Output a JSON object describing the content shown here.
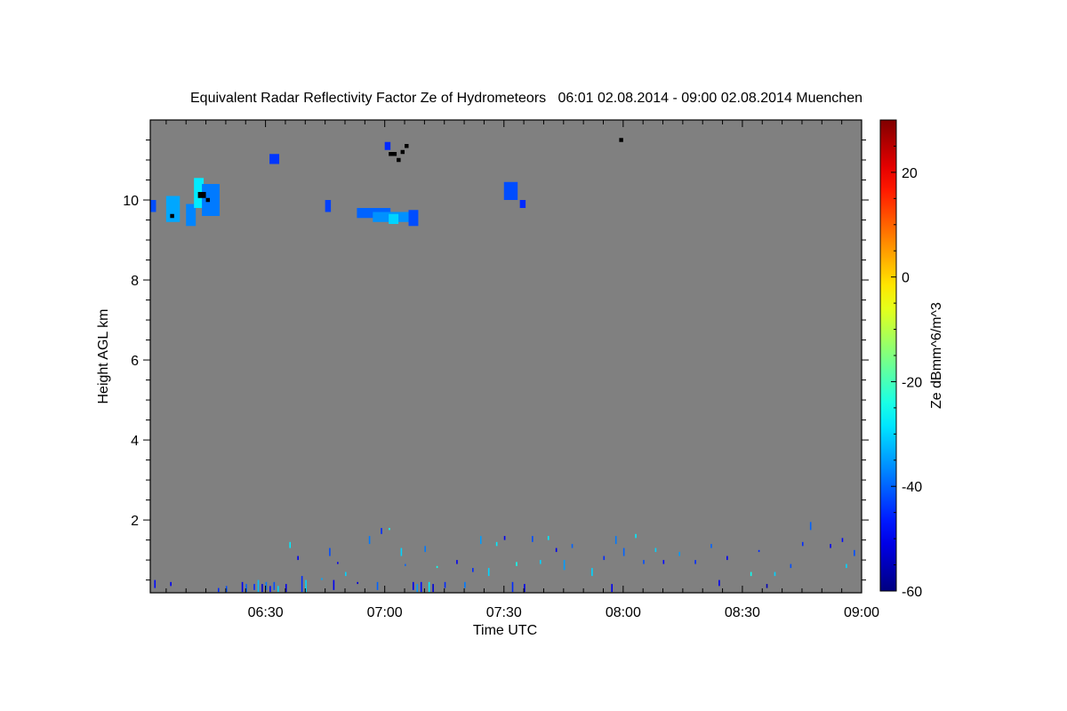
{
  "chart_data": {
    "type": "heatmap",
    "title": "Equivalent Radar Reflectivity Factor Ze of Hydrometeors   06:01 02.08.2014 - 09:00 02.08.2014 Muenchen",
    "xlabel": "Time UTC",
    "ylabel": "Height AGL km",
    "xlim": [
      "06:01",
      "09:00"
    ],
    "ylim": [
      0.18,
      12.0
    ],
    "xticks": [
      "06:30",
      "07:00",
      "07:30",
      "08:00",
      "08:30",
      "09:00"
    ],
    "yticks": [
      2,
      4,
      6,
      8,
      10
    ],
    "background_color": "#808080",
    "colorbar": {
      "label": "Ze dBmm^6/m^3",
      "range": [
        -60,
        30
      ],
      "ticks": [
        -60,
        -40,
        -20,
        0,
        20
      ],
      "colormap": "jet"
    },
    "echoes": [
      {
        "start": "06:01",
        "end": "06:02",
        "h": [
          9.7,
          10.0
        ],
        "ze": -42
      },
      {
        "start": "06:05",
        "end": "06:08",
        "h": [
          9.45,
          10.1
        ],
        "ze": -34
      },
      {
        "start": "06:10",
        "end": "06:12",
        "h": [
          9.35,
          9.9
        ],
        "ze": -37
      },
      {
        "start": "06:12",
        "end": "06:14",
        "h": [
          9.8,
          10.55
        ],
        "ze": -28
      },
      {
        "start": "06:14",
        "end": "06:18",
        "h": [
          9.6,
          10.4
        ],
        "ze": -38
      },
      {
        "start": "06:31",
        "end": "06:33",
        "h": [
          10.9,
          11.15
        ],
        "ze": -44
      },
      {
        "start": "06:45",
        "end": "06:46",
        "h": [
          9.7,
          10.0
        ],
        "ze": -43
      },
      {
        "start": "06:53",
        "end": "07:01",
        "h": [
          9.55,
          9.8
        ],
        "ze": -40
      },
      {
        "start": "06:57",
        "end": "07:06",
        "h": [
          9.45,
          9.7
        ],
        "ze": -36
      },
      {
        "start": "07:01",
        "end": "07:03",
        "h": [
          9.4,
          9.65
        ],
        "ze": -30
      },
      {
        "start": "07:06",
        "end": "07:08",
        "h": [
          9.35,
          9.75
        ],
        "ze": -42
      },
      {
        "start": "07:00",
        "end": "07:01",
        "h": [
          11.25,
          11.45
        ],
        "ze": -45
      },
      {
        "start": "07:30",
        "end": "07:33",
        "h": [
          10.0,
          10.45
        ],
        "ze": -42
      },
      {
        "start": "07:34",
        "end": "07:35",
        "h": [
          9.8,
          10.0
        ],
        "ze": -45
      }
    ],
    "no_data_flags": [
      {
        "start": "06:06",
        "end": "06:07",
        "h": [
          9.55,
          9.65
        ]
      },
      {
        "start": "06:13",
        "end": "06:15",
        "h": [
          10.05,
          10.2
        ]
      },
      {
        "start": "06:15",
        "end": "06:16",
        "h": [
          9.95,
          10.05
        ]
      },
      {
        "start": "07:01",
        "end": "07:03",
        "h": [
          11.1,
          11.2
        ]
      },
      {
        "start": "07:04",
        "end": "07:05",
        "h": [
          11.15,
          11.25
        ]
      },
      {
        "start": "07:05",
        "end": "07:06",
        "h": [
          11.3,
          11.4
        ]
      },
      {
        "start": "07:03",
        "end": "07:04",
        "h": [
          10.95,
          11.05
        ]
      },
      {
        "start": "07:59",
        "end": "08:00",
        "h": [
          11.45,
          11.55
        ]
      }
    ],
    "specks": [
      [
        "06:02",
        0.3,
        0.5,
        -48
      ],
      [
        "06:06",
        0.35,
        0.45,
        -50
      ],
      [
        "06:18",
        0.2,
        0.3,
        -45
      ],
      [
        "06:20",
        0.2,
        0.35,
        -42
      ],
      [
        "06:24",
        0.2,
        0.45,
        -50
      ],
      [
        "06:25",
        0.2,
        0.4,
        -40
      ],
      [
        "06:27",
        0.25,
        0.4,
        -45
      ],
      [
        "06:28",
        0.2,
        0.5,
        -32
      ],
      [
        "06:29",
        0.2,
        0.4,
        -52
      ],
      [
        "06:30",
        0.25,
        0.45,
        -38
      ],
      [
        "06:31",
        0.2,
        0.35,
        -48
      ],
      [
        "06:32",
        0.25,
        0.45,
        -42
      ],
      [
        "06:33",
        0.2,
        0.35,
        -30
      ],
      [
        "06:35",
        0.2,
        0.4,
        -50
      ],
      [
        "06:36",
        1.3,
        1.45,
        -28
      ],
      [
        "06:38",
        1.0,
        1.1,
        -50
      ],
      [
        "06:39",
        0.2,
        0.6,
        -45
      ],
      [
        "06:40",
        0.2,
        0.5,
        -30
      ],
      [
        "06:44",
        0.5,
        0.55,
        -34
      ],
      [
        "06:46",
        1.1,
        1.3,
        -42
      ],
      [
        "06:47",
        0.25,
        0.5,
        -50
      ],
      [
        "06:48",
        0.9,
        0.95,
        -50
      ],
      [
        "06:50",
        0.6,
        0.7,
        -30
      ],
      [
        "06:53",
        0.4,
        0.45,
        -52
      ],
      [
        "06:56",
        1.4,
        1.6,
        -38
      ],
      [
        "06:58",
        0.25,
        0.45,
        -40
      ],
      [
        "06:59",
        1.65,
        1.8,
        -45
      ],
      [
        "07:01",
        1.75,
        1.8,
        -25
      ],
      [
        "07:04",
        1.1,
        1.3,
        -30
      ],
      [
        "07:05",
        0.85,
        0.9,
        -40
      ],
      [
        "07:07",
        0.25,
        0.45,
        -50
      ],
      [
        "07:08",
        0.2,
        0.4,
        -35
      ],
      [
        "07:09",
        0.2,
        0.45,
        -48
      ],
      [
        "07:10",
        1.2,
        1.35,
        -38
      ],
      [
        "07:11",
        0.2,
        0.45,
        -28
      ],
      [
        "07:12",
        0.2,
        0.4,
        -52
      ],
      [
        "07:13",
        0.8,
        0.85,
        -25
      ],
      [
        "07:15",
        0.3,
        0.45,
        -45
      ],
      [
        "07:18",
        0.9,
        1.0,
        -50
      ],
      [
        "07:20",
        0.3,
        0.45,
        -38
      ],
      [
        "07:22",
        0.7,
        0.8,
        -45
      ],
      [
        "07:24",
        1.4,
        1.6,
        -35
      ],
      [
        "07:26",
        0.6,
        0.8,
        -30
      ],
      [
        "07:28",
        1.35,
        1.45,
        -28
      ],
      [
        "07:30",
        1.5,
        1.6,
        -50
      ],
      [
        "07:32",
        0.2,
        0.45,
        -45
      ],
      [
        "07:33",
        0.85,
        0.95,
        -25
      ],
      [
        "07:35",
        0.2,
        0.4,
        -50
      ],
      [
        "07:37",
        1.45,
        1.6,
        -42
      ],
      [
        "07:39",
        0.9,
        1.0,
        -30
      ],
      [
        "07:41",
        1.5,
        1.6,
        -28
      ],
      [
        "07:43",
        1.2,
        1.3,
        -50
      ],
      [
        "07:45",
        0.75,
        1.0,
        -35
      ],
      [
        "07:47",
        1.3,
        1.4,
        -40
      ],
      [
        "07:52",
        0.6,
        0.8,
        -30
      ],
      [
        "07:55",
        1.0,
        1.1,
        -45
      ],
      [
        "07:57",
        0.2,
        0.4,
        -50
      ],
      [
        "07:58",
        1.4,
        1.6,
        -38
      ],
      [
        "08:00",
        1.1,
        1.3,
        -40
      ],
      [
        "08:03",
        1.55,
        1.65,
        -28
      ],
      [
        "08:05",
        0.9,
        1.0,
        -42
      ],
      [
        "08:08",
        1.2,
        1.3,
        -30
      ],
      [
        "08:10",
        0.9,
        1.0,
        -48
      ],
      [
        "08:14",
        1.1,
        1.2,
        -35
      ],
      [
        "08:18",
        0.9,
        1.0,
        -45
      ],
      [
        "08:22",
        1.3,
        1.4,
        -40
      ],
      [
        "08:24",
        0.35,
        0.5,
        -50
      ],
      [
        "08:26",
        1.0,
        1.1,
        -50
      ],
      [
        "08:32",
        0.6,
        0.7,
        -25
      ],
      [
        "08:34",
        1.2,
        1.25,
        -45
      ],
      [
        "08:36",
        0.3,
        0.4,
        -55
      ],
      [
        "08:38",
        0.6,
        0.7,
        -30
      ],
      [
        "08:42",
        0.8,
        0.9,
        -42
      ],
      [
        "08:45",
        1.35,
        1.45,
        -45
      ],
      [
        "08:47",
        1.75,
        1.95,
        -40
      ],
      [
        "08:52",
        1.3,
        1.4,
        -50
      ],
      [
        "08:55",
        1.45,
        1.55,
        -48
      ],
      [
        "08:56",
        0.8,
        0.9,
        -30
      ],
      [
        "08:58",
        1.1,
        1.25,
        -42
      ]
    ]
  }
}
